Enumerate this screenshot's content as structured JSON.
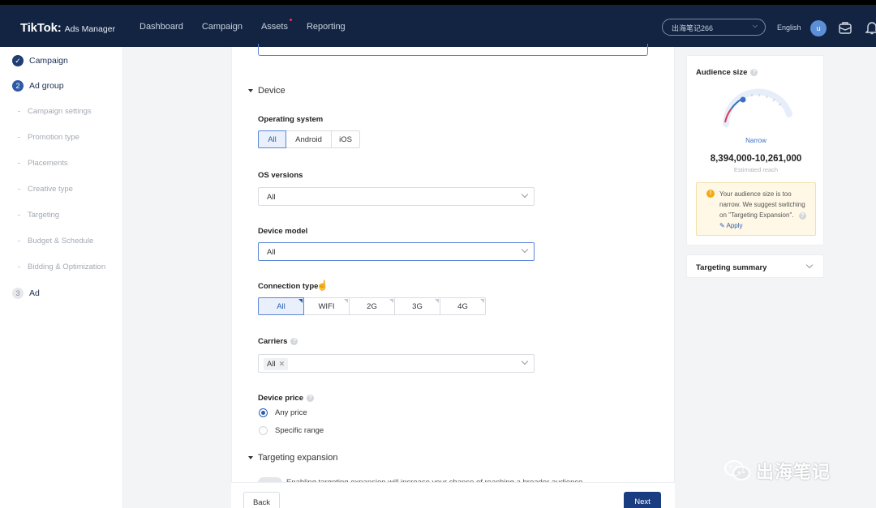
{
  "header": {
    "logo_main": "TikTok:",
    "logo_sub": "Ads Manager",
    "nav": [
      {
        "label": "Dashboard"
      },
      {
        "label": "Campaign"
      },
      {
        "label": "Assets"
      },
      {
        "label": "Reporting"
      }
    ],
    "account": "出海笔记266",
    "language": "English",
    "avatar_letter": "u"
  },
  "sidebar": {
    "steps": [
      {
        "num": "",
        "label": "Campaign",
        "state": "done"
      },
      {
        "num": "2",
        "label": "Ad group",
        "state": "active"
      },
      {
        "num": "3",
        "label": "Ad",
        "state": "pending"
      }
    ],
    "substeps": [
      {
        "label": "Campaign settings"
      },
      {
        "label": "Promotion type"
      },
      {
        "label": "Placements"
      },
      {
        "label": "Creative type"
      },
      {
        "label": "Targeting"
      },
      {
        "label": "Budget & Schedule"
      },
      {
        "label": "Bidding & Optimization"
      }
    ]
  },
  "device": {
    "section_title": "Device",
    "os_label": "Operating system",
    "os_options": [
      "All",
      "Android",
      "iOS"
    ],
    "os_selected": "All",
    "os_versions_label": "OS versions",
    "os_versions_value": "All",
    "device_model_label": "Device model",
    "device_model_value": "All",
    "connection_label": "Connection type",
    "connection_options": [
      "All",
      "WIFI",
      "2G",
      "3G",
      "4G"
    ],
    "connection_selected": "All",
    "carriers_label": "Carriers",
    "carriers_tag": "All",
    "price_label": "Device price",
    "price_options": [
      "Any price",
      "Specific range"
    ],
    "price_selected": "Any price"
  },
  "expansion": {
    "section_title": "Targeting expansion",
    "note": "Enabling targeting expansion will increase your chance of reaching a broader audience"
  },
  "footer": {
    "back": "Back",
    "next": "Next"
  },
  "audience": {
    "title": "Audience size",
    "level": "Narrow",
    "reach": "8,394,000-10,261,000",
    "reach_sub": "Estimated reach",
    "warning": "Your audience size is too narrow. We suggest switching on \"Targeting Expansion\".",
    "apply": "Apply"
  },
  "summary": {
    "title": "Targeting summary"
  },
  "watermark": "出海笔记",
  "colors": {
    "header_bg": "#122442",
    "accent": "#2a5db0",
    "next_button": "#1a3d82",
    "warning_bg": "#fff8e6"
  }
}
